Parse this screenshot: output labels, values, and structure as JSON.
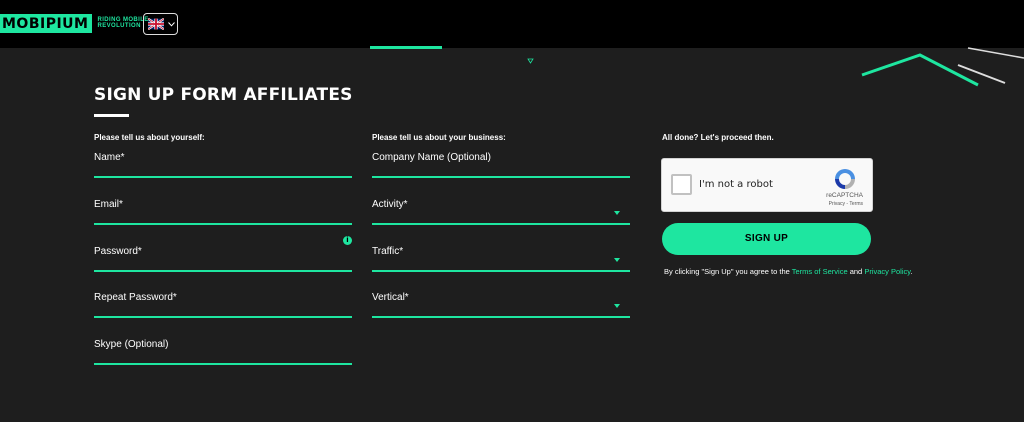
{
  "header": {
    "logo_text": "MOBIPIUM",
    "logo_tagline": "RIDING MOBILE REVOLUTION",
    "language_icon": "uk-flag-icon"
  },
  "page": {
    "title": "SIGN UP FORM AFFILIATES"
  },
  "about_you": {
    "heading": "Please tell us about yourself:",
    "name_label": "Name*",
    "email_label": "Email*",
    "password_label": "Password*",
    "repeat_password_label": "Repeat Password*",
    "skype_label": "Skype (Optional)"
  },
  "business": {
    "heading": "Please tell us about your business:",
    "company_label": "Company Name (Optional)",
    "activity_label": "Activity*",
    "traffic_label": "Traffic*",
    "vertical_label": "Vertical*"
  },
  "finish": {
    "heading": "All done? Let's proceed then.",
    "captcha_text": "I'm not a robot",
    "captcha_brand": "reCAPTCHA",
    "captcha_privacy": "Privacy",
    "captcha_sep": " - ",
    "captcha_terms": "Terms",
    "signup_label": "SIGN UP",
    "legal_prefix": "By clicking \"Sign Up\" you agree to the ",
    "terms_link": "Terms of Service",
    "legal_and": " and ",
    "privacy_link": "Privacy Policy",
    "legal_suffix": "."
  },
  "colors": {
    "accent": "#1ee6a0",
    "background": "#1e1e1e",
    "header": "#000000"
  }
}
